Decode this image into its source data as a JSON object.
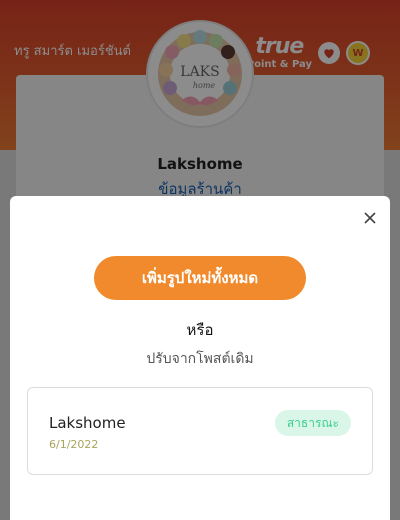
{
  "app": {
    "merchant_label": "ทรู สมาร์ต เมอร์ชันต์",
    "brand_name": "true",
    "brand_subtitle": "Point & Pay",
    "brand_badge": "W"
  },
  "store": {
    "logo_text": "LAKS",
    "logo_subtext": "home",
    "name": "Lakshome",
    "info_link": "ข้อมูลร้านค้า"
  },
  "modal": {
    "close_icon": "close-icon",
    "primary_button_label": "เพิ่มรูปใหม่ทั้งหมด",
    "or_text": "หรือ",
    "adjust_text": "ปรับจากโพสต์เดิม",
    "post": {
      "title": "Lakshome",
      "date": "6/1/2022",
      "status": "สาธารณะ"
    }
  },
  "colors": {
    "header_top": "#d8402a",
    "header_bottom": "#ec7a34",
    "primary_button": "#f08a2c",
    "link": "#1a5fb4",
    "status_bg": "#d9f6e9",
    "status_text": "#3ecf8e",
    "date_text": "#a8a45c"
  }
}
